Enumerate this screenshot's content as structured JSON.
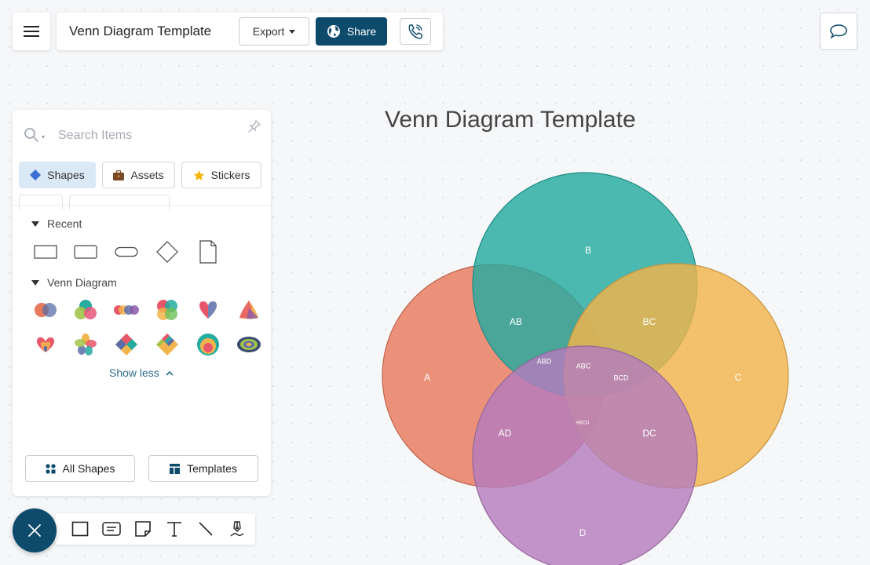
{
  "app": {
    "document_title": "Venn Diagram Template",
    "export_label": "Export",
    "share_label": "Share",
    "icons": {
      "menu": "hamburger-menu-icon",
      "export_caret": "caret-down-icon",
      "share": "globe-icon",
      "call": "phone-call-icon",
      "comment": "chat-bubble-icon"
    }
  },
  "sidebar": {
    "search": {
      "placeholder": "Search Items",
      "value": ""
    },
    "tabs": [
      {
        "label": "Shapes",
        "icon": "diamond-icon",
        "active": true
      },
      {
        "label": "Assets",
        "icon": "briefcase-icon",
        "active": false
      },
      {
        "label": "Stickers",
        "icon": "star-icon",
        "active": false
      }
    ],
    "recent": {
      "title": "Recent",
      "shapes": [
        "rectangle",
        "rounded-rectangle",
        "pill",
        "diamond",
        "document"
      ]
    },
    "venn": {
      "title": "Venn Diagram",
      "shapes": [
        "venn-2",
        "venn-3",
        "venn-4-row",
        "venn-4-grid",
        "venn-heart",
        "venn-triangle",
        "venn-heart-stack",
        "venn-flower",
        "venn-diamond-grid",
        "venn-diamond-stripes",
        "venn-concentric",
        "venn-ellipse-nested"
      ]
    },
    "show_less_label": "Show less",
    "all_shapes_label": "All Shapes",
    "templates_label": "Templates"
  },
  "toolbar": {
    "close_icon": "close-icon",
    "tools": [
      "rectangle-tool-icon",
      "textbox-tool-icon",
      "sticky-note-tool-icon",
      "text-tool-icon",
      "line-tool-icon",
      "pen-tool-icon"
    ]
  },
  "diagram": {
    "title": "Venn Diagram Template",
    "colors": {
      "A": "#e87a5d",
      "B": "#25aba0",
      "C": "#f2b44c",
      "D": "#b47cbd"
    },
    "labels": {
      "A": "A",
      "B": "B",
      "C": "C",
      "D": "D",
      "AB": "AB",
      "BC": "BC",
      "AD": "AD",
      "DC": "DC",
      "ABD": "ABD",
      "ABC": "ABC",
      "BCD": "BCD",
      "ABCD": "ABCD"
    }
  }
}
